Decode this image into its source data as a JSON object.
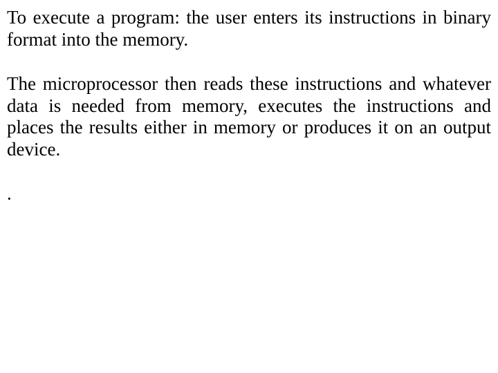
{
  "paragraphs": {
    "p1": "To execute a program: the user enters its instructions in binary format into the memory.",
    "p2": "The microprocessor then reads these instructions and whatever data is needed from memory, executes the instructions and places the results either in memory or produces it on an output device.",
    "p3": "."
  }
}
